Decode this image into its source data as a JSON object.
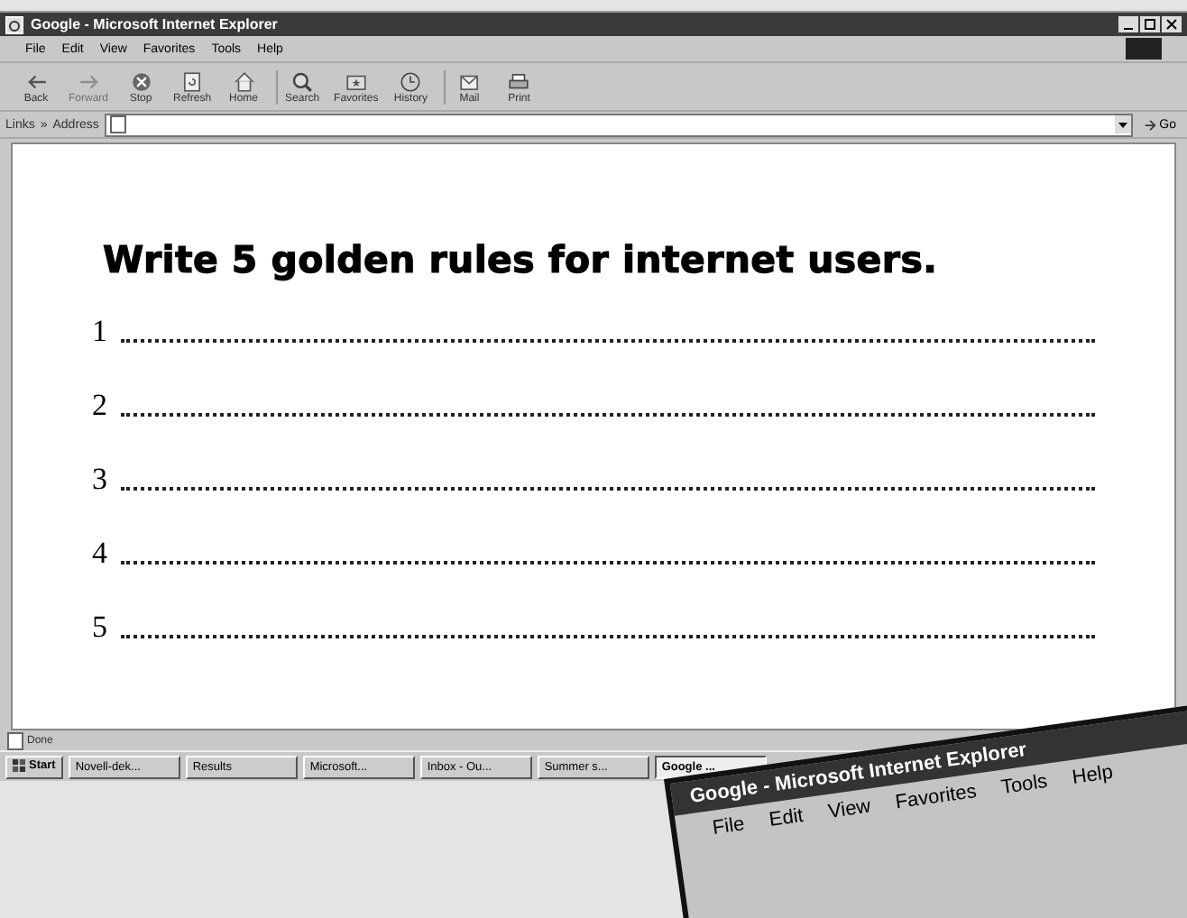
{
  "window": {
    "title": "Google - Microsoft Internet Explorer"
  },
  "menu": [
    "File",
    "Edit",
    "View",
    "Favorites",
    "Tools",
    "Help"
  ],
  "toolbar": [
    {
      "kind": "back",
      "label": "Back",
      "disabled": false
    },
    {
      "kind": "forward",
      "label": "Forward",
      "disabled": true
    },
    {
      "kind": "stop",
      "label": "Stop",
      "disabled": false
    },
    {
      "kind": "refresh",
      "label": "Refresh",
      "disabled": false
    },
    {
      "kind": "home",
      "label": "Home",
      "disabled": false
    },
    {
      "kind": "search",
      "label": "Search",
      "disabled": false
    },
    {
      "kind": "favorites",
      "label": "Favorites",
      "disabled": false
    },
    {
      "kind": "history",
      "label": "History",
      "disabled": false
    },
    {
      "kind": "mail",
      "label": "Mail",
      "disabled": false
    },
    {
      "kind": "print",
      "label": "Print",
      "disabled": false
    }
  ],
  "address_bar": {
    "links": "Links",
    "chevron": "»",
    "label": "Address",
    "go": "Go"
  },
  "content": {
    "heading": "Write 5 golden rules for internet users.",
    "rules": [
      "1",
      "2",
      "3",
      "4",
      "5"
    ]
  },
  "status_bar": "Done",
  "taskbar": {
    "start": "Start",
    "items": [
      {
        "label": "Novell-dek...",
        "selected": false
      },
      {
        "label": "Results",
        "selected": false
      },
      {
        "label": "Microsoft...",
        "selected": false
      },
      {
        "label": "Inbox - Ou...",
        "selected": false
      },
      {
        "label": "Summer s...",
        "selected": false
      },
      {
        "label": "Google ...",
        "selected": true
      }
    ]
  },
  "inset": {
    "title": "Google - Microsoft Internet Explorer",
    "menu": [
      "File",
      "Edit",
      "View",
      "Favorites",
      "Tools",
      "Help"
    ]
  }
}
